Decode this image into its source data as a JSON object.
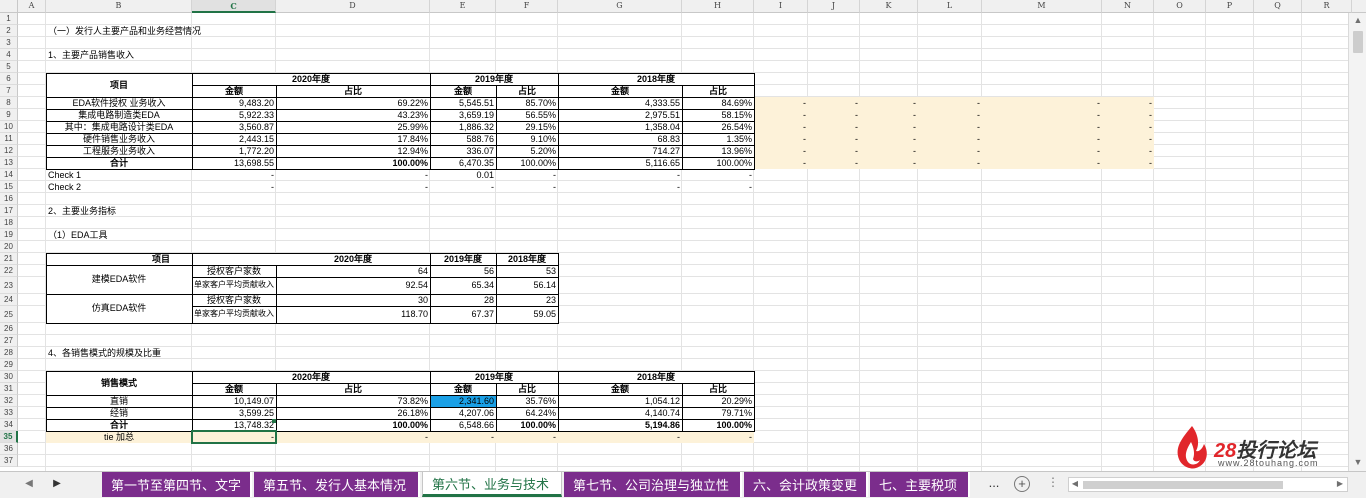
{
  "columns": [
    "A",
    "B",
    "C",
    "D",
    "E",
    "F",
    "G",
    "H",
    "I",
    "J",
    "K",
    "L",
    "M",
    "N",
    "O",
    "P",
    "Q",
    "R",
    "S"
  ],
  "active_column": "C",
  "active_row": "35",
  "sheet_text": {
    "t2": "（一）发行人主要产品和业务经营情况",
    "t4": "1、主要产品销售收入",
    "item": "项目",
    "y2020": "2020年度",
    "y2019": "2019年度",
    "y2018": "2018年度",
    "amount": "金额",
    "ratio": "占比",
    "t17": "2、主要业务指标",
    "t19": "（1）EDA工具",
    "t28": "4、各销售模式的规模及比重",
    "sales_mode": "销售模式"
  },
  "table1": {
    "rows": [
      {
        "label": "EDA软件授权 业务收入",
        "c": "9,483.20",
        "d": "69.22%",
        "e": "5,545.51",
        "f": "85.70%",
        "g": "4,333.55",
        "h": "84.69%"
      },
      {
        "label": "集成电路制造类EDA",
        "c": "5,922.33",
        "d": "43.23%",
        "e": "3,659.19",
        "f": "56.55%",
        "g": "2,975.51",
        "h": "58.15%"
      },
      {
        "label": "其中：集成电路设计类EDA",
        "c": "3,560.87",
        "d": "25.99%",
        "e": "1,886.32",
        "f": "29.15%",
        "g": "1,358.04",
        "h": "26.54%"
      },
      {
        "label": "硬件销售业务收入",
        "c": "2,443.15",
        "d": "17.84%",
        "e": "588.76",
        "f": "9.10%",
        "g": "68.83",
        "h": "1.35%"
      },
      {
        "label": "工程服务业务收入",
        "c": "1,772.20",
        "d": "12.94%",
        "e": "336.07",
        "f": "5.20%",
        "g": "714.27",
        "h": "13.96%"
      },
      {
        "label": "合计",
        "c": "13,698.55",
        "d": "100.00%",
        "e": "6,470.35",
        "f": "100.00%",
        "g": "5,116.65",
        "h": "100.00%"
      }
    ],
    "dash": "-",
    "check1": {
      "label": "Check 1",
      "c": "-",
      "d": "-",
      "e": "0.01",
      "f": "-",
      "g": "-",
      "h": "-"
    },
    "check2": {
      "label": "Check 2",
      "c": "-",
      "d": "-",
      "e": "-",
      "f": "-",
      "g": "-",
      "h": "-"
    }
  },
  "table2": {
    "groups": [
      {
        "name": "建模EDA软件",
        "rows": [
          {
            "label": "授权客户家数",
            "y2020": "64",
            "y2019": "56",
            "y2018": "53"
          },
          {
            "label": "单家客户平均贡献收入",
            "y2020": "92.54",
            "y2019": "65.34",
            "y2018": "56.14"
          }
        ]
      },
      {
        "name": "仿真EDA软件",
        "rows": [
          {
            "label": "授权客户家数",
            "y2020": "30",
            "y2019": "28",
            "y2018": "23"
          },
          {
            "label": "单家客户平均贡献收入",
            "y2020": "118.70",
            "y2019": "67.37",
            "y2018": "59.05"
          }
        ]
      }
    ]
  },
  "table3": {
    "rows": [
      {
        "label": "直销",
        "c": "10,149.07",
        "d": "73.82%",
        "e": "2,341.60",
        "f": "35.76%",
        "g": "1,054.12",
        "h": "20.29%"
      },
      {
        "label": "经销",
        "c": "3,599.25",
        "d": "26.18%",
        "e": "4,207.06",
        "f": "64.24%",
        "g": "4,140.74",
        "h": "79.71%"
      },
      {
        "label": "合计",
        "c": "13,748.32",
        "d": "100.00%",
        "e": "6,548.66",
        "f": "100.00%",
        "g": "5,194.86",
        "h": "100.00%"
      }
    ],
    "tie": {
      "label": "tie 加总",
      "c": "-",
      "d": "-",
      "e": "-",
      "f": "-",
      "g": "-",
      "h": "-"
    }
  },
  "sheet_tabs": [
    {
      "label": "第一节至第四节、文字",
      "active": false
    },
    {
      "label": "第五节、发行人基本情况",
      "active": false
    },
    {
      "label": "第六节、业务与技术",
      "active": true
    },
    {
      "label": "第七节、公司治理与独立性",
      "active": false
    },
    {
      "label": "六、会计政策变更",
      "active": false
    },
    {
      "label": "七、主要税项",
      "active": false
    }
  ],
  "more_tabs": "...",
  "add_sheet": "+",
  "logo": {
    "number": "28",
    "text": "投行论坛",
    "url": "www.28touhang.com"
  },
  "colors": {
    "accent": "#217346",
    "tab": "#7b2d8c",
    "fill": "#fdf2d9",
    "highlight": "#1aa0e6"
  }
}
